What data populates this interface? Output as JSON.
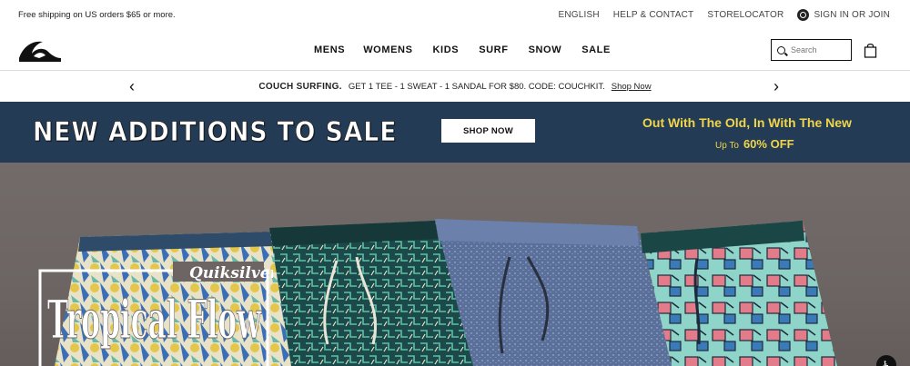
{
  "topbar": {
    "shipping": "Free shipping on US orders $65 or more.",
    "links": [
      "ENGLISH",
      "HELP & CONTACT",
      "STORELOCATOR"
    ],
    "signin": "SIGN IN OR JOIN"
  },
  "nav": {
    "items": [
      "MENS",
      "WOMENS",
      "KIDS",
      "SURF",
      "SNOW",
      "SALE"
    ],
    "search_placeholder": "Search"
  },
  "promo": {
    "bold": "COUCH SURFING.",
    "text": "GET 1 TEE - 1 SWEAT - 1 SANDAL FOR $80. CODE: COUCHKIT.",
    "link": "Shop Now"
  },
  "sale_banner": {
    "headline": "NEW ADDITIONS TO SALE",
    "button": "SHOP NOW",
    "tagline": "Out With The Old, In With The New",
    "upto": "Up To",
    "percent": "60% OFF"
  },
  "hero": {
    "brand": "Quiksilver",
    "title": "Tropical Flow"
  },
  "colors": {
    "banner_bg": "#243b55",
    "accent_yellow": "#f0d64a"
  }
}
